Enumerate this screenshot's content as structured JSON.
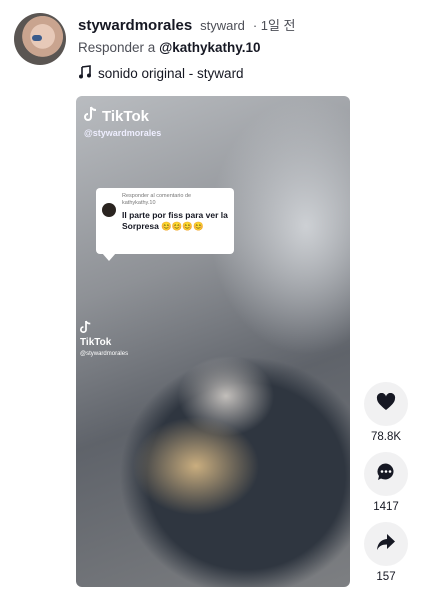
{
  "header": {
    "username": "stywardmorales",
    "nickname": "styward",
    "time": "· 1일 전",
    "reply_prefix": "Responder a ",
    "reply_mention": "@kathykathy.10",
    "sound": "sonido original - styward"
  },
  "video": {
    "watermark_brand": "TikTok",
    "watermark_handle": "@stywardmorales",
    "watermark_handle_small": "@stywardmorales",
    "bubble": {
      "reply_label": "Responder al comentario de",
      "reply_user": "kathykathy.10",
      "comment": "Il parte por fiss para ver la Sorpresa 😊😊😊😊"
    }
  },
  "actions": {
    "likes": "78.8K",
    "comments": "1417",
    "shares": "157"
  },
  "icons": {
    "like": "heart-icon",
    "comment": "comment-icon",
    "share": "share-icon",
    "music": "music-note-icon"
  }
}
